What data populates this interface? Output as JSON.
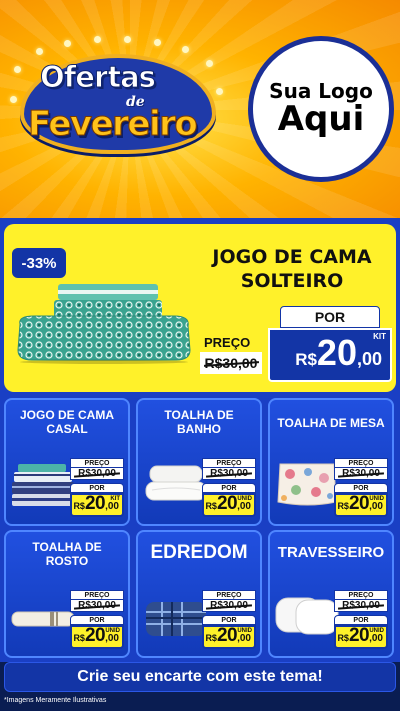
{
  "header": {
    "badge": {
      "line1": "Ofertas",
      "line2": "de",
      "line3": "Fevereiro"
    },
    "logo": {
      "line1": "Sua Logo",
      "line2": "Aqui"
    }
  },
  "featured": {
    "discount": "-33%",
    "title": "JOGO DE CAMA SOLTEIRO",
    "price_label": "PREÇO",
    "old_price": "R$30,00",
    "por_label": "POR",
    "currency": "R$",
    "new_int": "20",
    "new_cents": ",00",
    "kit": "KIT",
    "image": "bedding-set-icon"
  },
  "products": [
    {
      "title": "JOGO DE CAMA CASAL",
      "price_label": "PREÇO",
      "old_price": "R$30,00",
      "por_label": "POR",
      "currency": "R$",
      "new_int": "20",
      "new_cents": ",00",
      "tag": "KIT",
      "image": "stacked-bedding-icon"
    },
    {
      "title": "TOALHA DE BANHO",
      "price_label": "PREÇO",
      "old_price": "R$30,00",
      "por_label": "POR",
      "currency": "R$",
      "new_int": "20",
      "new_cents": ",00",
      "tag": "UNID",
      "image": "white-towels-icon"
    },
    {
      "title": "TOALHA DE MESA",
      "price_label": "PREÇO",
      "old_price": "R$30,00",
      "por_label": "POR",
      "currency": "R$",
      "new_int": "20",
      "new_cents": ",00",
      "tag": "UNID",
      "image": "floral-tablecloth-icon"
    },
    {
      "title": "TOALHA DE ROSTO",
      "price_label": "PREÇO",
      "old_price": "R$30,00",
      "por_label": "POR",
      "currency": "R$",
      "new_int": "20",
      "new_cents": ",00",
      "tag": "UNID",
      "image": "face-towel-icon"
    },
    {
      "title": "EDREDOM",
      "price_label": "PREÇO",
      "old_price": "R$30,00",
      "por_label": "POR",
      "currency": "R$",
      "new_int": "20",
      "new_cents": ",00",
      "tag": "UNID",
      "image": "plaid-comforter-icon"
    },
    {
      "title": "TRAVESSEIRO",
      "price_label": "PREÇO",
      "old_price": "R$30,00",
      "por_label": "POR",
      "currency": "R$",
      "new_int": "20",
      "new_cents": ",00",
      "tag": "UNID",
      "image": "pillows-icon"
    }
  ],
  "cta": "Crie seu encarte com este tema!",
  "disclaimer": "*Imagens Meramente Ilustrativas",
  "colors": {
    "brand_blue": "#1335a6",
    "card_blue": "#1a3fc4",
    "highlight_yellow": "#fff12a",
    "header_orange": "#f58a00"
  }
}
